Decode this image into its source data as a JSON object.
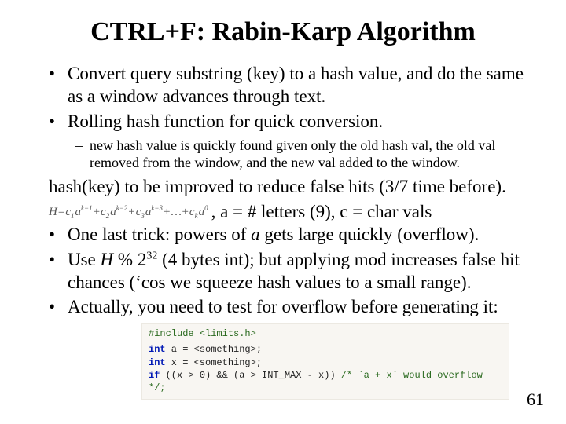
{
  "title": "CTRL+F: Rabin-Karp Algorithm",
  "bullets_top": [
    "Convert query substring (key) to a hash value, and do the same as a window advances through text.",
    "Rolling hash function for quick conversion."
  ],
  "sub_bullet": "new hash value is quickly found given only the old hash val, the old val removed from the window, and the new val added to the window.",
  "para1": "hash(key) to be improved to reduce false hits (3/7 time before).",
  "formula": {
    "H": "H",
    "eq": " = ",
    "t1_c": "c",
    "t1_ci": "1",
    "t1_a": "a",
    "t1_e": "k−1",
    "plus": "+",
    "t2_c": "c",
    "t2_ci": "2",
    "t2_a": "a",
    "t2_e": "k−2",
    "t3_c": "c",
    "t3_ci": "3",
    "t3_a": "a",
    "t3_e": "k−3",
    "dots": "+…+",
    "tk_c": "c",
    "tk_ci": "k",
    "tk_a": "a",
    "tk_e": "0"
  },
  "formula_tail": " , a = # letters (9), c = char vals",
  "bullets_bottom": [
    {
      "pre": "One last trick: powers of ",
      "it": "a",
      "post": " gets large quickly (overflow)."
    },
    {
      "pre": "Use ",
      "it": "H",
      "post1": " % 2",
      "sup": "32",
      "post2": " (4 bytes int); but applying mod increases false hit chances (‘cos we squeeze hash values to a small range)."
    },
    {
      "pre": "Actually, you need to test for overflow before generating it:",
      "it": "",
      "post": ""
    }
  ],
  "code": {
    "l1": "#include <limits.h>",
    "l2a": "int",
    "l2b": " a = <something>;",
    "l3a": "int",
    "l3b": " x = <something>;",
    "l4a": "if",
    "l4b": " ((x > 0) && (a > INT_MAX - x)) ",
    "l4c": "/* `a + x` would overflow */;"
  },
  "page_num": "61"
}
